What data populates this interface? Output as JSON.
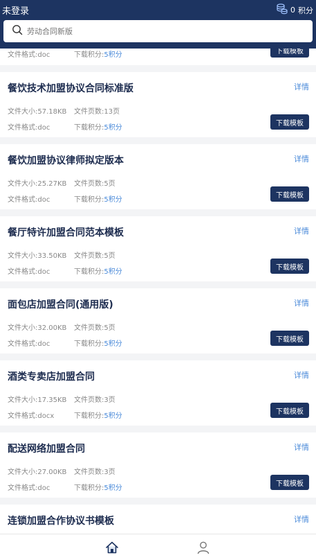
{
  "header": {
    "title": "未登录",
    "points_value": "0",
    "points_label": "积分"
  },
  "search": {
    "placeholder": "劳动合同新版"
  },
  "top_partial": {
    "format_label": "文件格式:doc",
    "points_label": "下载积分:",
    "points_value": "5积分",
    "download_label": "下载模板"
  },
  "items": [
    {
      "title": "餐饮技术加盟协议合同标准版",
      "detail": "详情",
      "size": "文件大小:57.18KB",
      "pages": "文件页数:13页",
      "format": "文件格式:doc",
      "points_label": "下载积分:",
      "points_value": "5积分",
      "download": "下载模板"
    },
    {
      "title": "餐饮加盟协议律师拟定版本",
      "detail": "详情",
      "size": "文件大小:25.27KB",
      "pages": "文件页数:5页",
      "format": "文件格式:doc",
      "points_label": "下载积分:",
      "points_value": "5积分",
      "download": "下载模板"
    },
    {
      "title": "餐厅特许加盟合同范本模板",
      "detail": "详情",
      "size": "文件大小:33.50KB",
      "pages": "文件页数:5页",
      "format": "文件格式:doc",
      "points_label": "下载积分:",
      "points_value": "5积分",
      "download": "下载模板"
    },
    {
      "title": "面包店加盟合同(通用版)",
      "detail": "详情",
      "size": "文件大小:32.00KB",
      "pages": "文件页数:5页",
      "format": "文件格式:doc",
      "points_label": "下载积分:",
      "points_value": "5积分",
      "download": "下载模板"
    },
    {
      "title": "酒类专卖店加盟合同",
      "detail": "详情",
      "size": "文件大小:17.35KB",
      "pages": "文件页数:3页",
      "format": "文件格式:docx",
      "points_label": "下载积分:",
      "points_value": "5积分",
      "download": "下载模板"
    },
    {
      "title": "配送网络加盟合同",
      "detail": "详情",
      "size": "文件大小:27.00KB",
      "pages": "文件页数:3页",
      "format": "文件格式:doc",
      "points_label": "下载积分:",
      "points_value": "5积分",
      "download": "下载模板"
    },
    {
      "title": "连锁加盟合作协议书模板",
      "detail": "详情"
    }
  ],
  "icons": {
    "coins": "coins-icon",
    "search": "search-icon",
    "home": "home-icon",
    "user": "user-icon"
  },
  "colors": {
    "brand": "#1d3461",
    "accent": "#4a8ad9"
  }
}
